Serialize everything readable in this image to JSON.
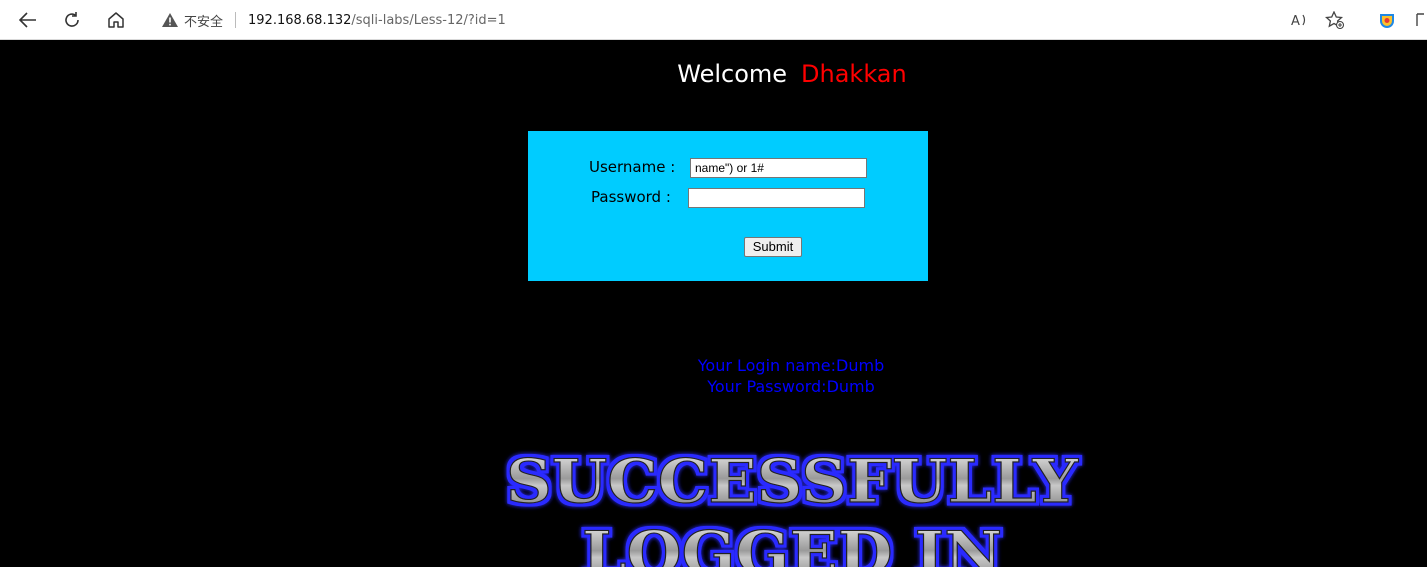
{
  "browser": {
    "security_label": "不安全",
    "url_host": "192.168.68.132",
    "url_path": "/sqli-labs/Less-12/?id=1",
    "icons": {
      "back": "back-arrow-icon",
      "reload": "reload-icon",
      "home": "home-icon",
      "warning": "warning-icon",
      "read_aloud": "read-aloud-icon",
      "favorite": "add-favorite-icon",
      "extension": "extension-icon"
    }
  },
  "page": {
    "welcome_text": "Welcome",
    "welcome_name": "Dhakkan",
    "form": {
      "username_label": "Username :",
      "username_value": "name\") or 1#",
      "password_label": "Password :",
      "password_value": "",
      "submit_label": "Submit"
    },
    "result": {
      "login_name_line": "Your Login name:Dumb",
      "password_line": "Your Password:Dumb"
    },
    "banner": {
      "line1": "SUCCESSFULLY",
      "line2": "LOGGED IN"
    },
    "colors": {
      "background": "#000000",
      "welcome": "#ffffff",
      "name": "#ff0000",
      "form_bg": "#00ccff",
      "result_text": "#0000ff"
    }
  }
}
